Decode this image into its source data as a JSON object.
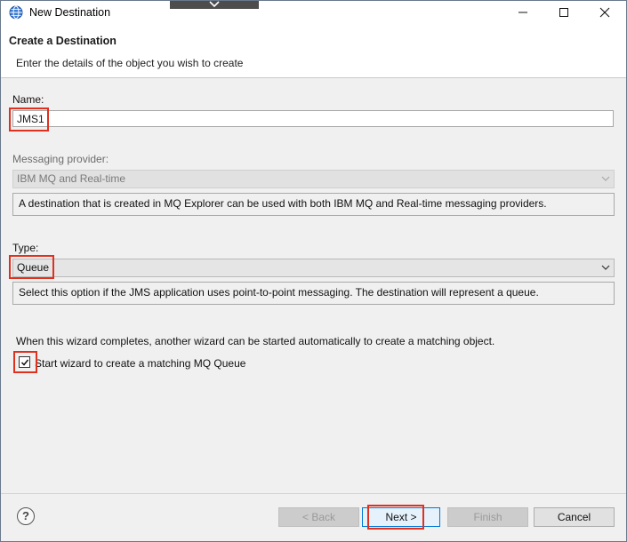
{
  "window": {
    "title": "New Destination"
  },
  "header": {
    "title": "Create a Destination",
    "subtitle": "Enter the details of the object you wish to create"
  },
  "form": {
    "name_label": "Name:",
    "name_value": "JMS1",
    "provider_label": "Messaging provider:",
    "provider_value": "IBM MQ and Real-time",
    "provider_description": "A destination that is created in MQ Explorer can be used with both IBM MQ and Real-time messaging providers.",
    "type_label": "Type:",
    "type_value": "Queue",
    "type_description": "Select this option if the JMS application uses point-to-point messaging. The destination will represent a queue.",
    "wizard_note": "When this wizard completes, another wizard can be started automatically to create a matching object.",
    "wizard_checkbox_label": "Start wizard to create a matching MQ Queue",
    "wizard_checkbox_checked": true
  },
  "footer": {
    "help_label": "?",
    "back_label": "< Back",
    "next_label": "Next >",
    "finish_label": "Finish",
    "cancel_label": "Cancel"
  },
  "colors": {
    "highlight": "#e0301e",
    "focus_border": "#0078d7"
  }
}
